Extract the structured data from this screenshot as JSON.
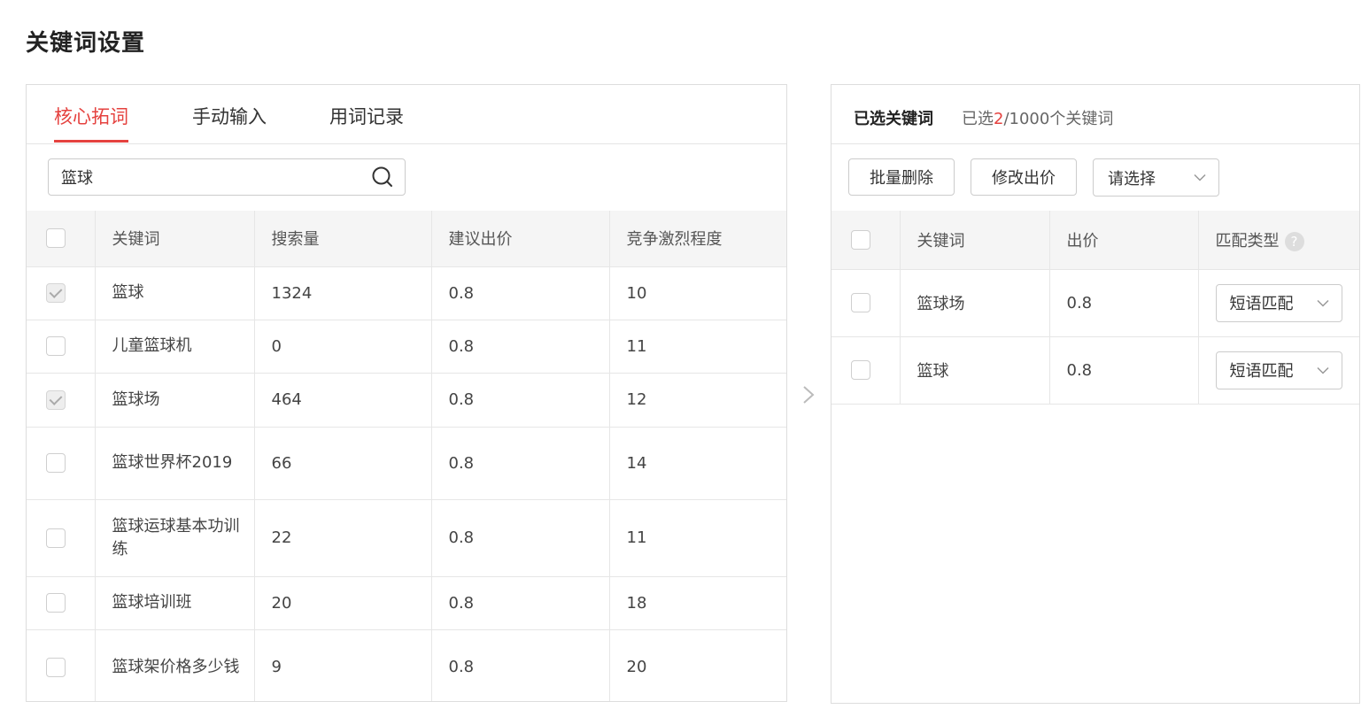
{
  "page_title": "关键词设置",
  "left": {
    "tabs": [
      {
        "label": "核心拓词",
        "active": true
      },
      {
        "label": "手动输入",
        "active": false
      },
      {
        "label": "用词记录",
        "active": false
      }
    ],
    "search": {
      "value": "篮球",
      "icon": "search-icon"
    },
    "table": {
      "headers": [
        "关键词",
        "搜索量",
        "建议出价",
        "竞争激烈程度"
      ],
      "rows": [
        {
          "checked": true,
          "keyword": "篮球",
          "search_volume": "1324",
          "bid": "0.8",
          "competition": "10"
        },
        {
          "checked": false,
          "keyword": "儿童篮球机",
          "search_volume": "0",
          "bid": "0.8",
          "competition": "11"
        },
        {
          "checked": true,
          "keyword": "篮球场",
          "search_volume": "464",
          "bid": "0.8",
          "competition": "12"
        },
        {
          "checked": false,
          "keyword": "篮球世界杯2019",
          "search_volume": "66",
          "bid": "0.8",
          "competition": "14"
        },
        {
          "checked": false,
          "keyword": "篮球运球基本功训练",
          "search_volume": "22",
          "bid": "0.8",
          "competition": "11"
        },
        {
          "checked": false,
          "keyword": "篮球培训班",
          "search_volume": "20",
          "bid": "0.8",
          "competition": "18"
        },
        {
          "checked": false,
          "keyword": "篮球架价格多少钱",
          "search_volume": "9",
          "bid": "0.8",
          "competition": "20"
        }
      ]
    }
  },
  "transfer_icon": "chevron-right-icon",
  "right": {
    "title": "已选关键词",
    "count_prefix": "已选",
    "count_selected": "2",
    "count_suffix": "/1000个关键词",
    "toolbar": {
      "batch_delete_label": "批量删除",
      "edit_bid_label": "修改出价",
      "select_placeholder": "请选择"
    },
    "table": {
      "headers": [
        "关键词",
        "出价",
        "匹配类型"
      ],
      "help_glyph": "?",
      "rows": [
        {
          "checked": false,
          "keyword": "篮球场",
          "bid": "0.8",
          "match_type": "短语匹配"
        },
        {
          "checked": false,
          "keyword": "篮球",
          "bid": "0.8",
          "match_type": "短语匹配"
        }
      ]
    }
  },
  "colors": {
    "accent": "#e5423f",
    "border": "#dddddd",
    "header_bg": "#f5f5f5"
  }
}
